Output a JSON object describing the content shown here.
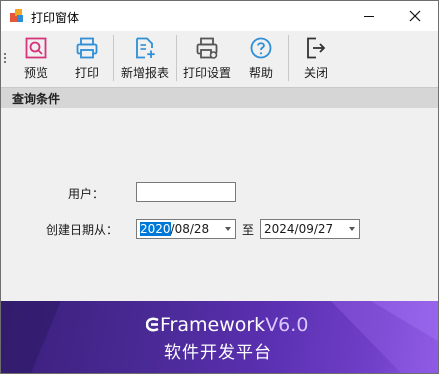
{
  "window": {
    "title": "打印窗体"
  },
  "toolbar": {
    "items": [
      {
        "label": "预览",
        "icon": "preview-icon"
      },
      {
        "label": "打印",
        "icon": "printer-icon"
      },
      {
        "label": "新增报表",
        "icon": "new-report-icon"
      },
      {
        "label": "打印设置",
        "icon": "print-settings-icon"
      },
      {
        "label": "帮助",
        "icon": "help-icon"
      },
      {
        "label": "关闭",
        "icon": "exit-icon"
      }
    ]
  },
  "section": {
    "title": "查询条件"
  },
  "form": {
    "user_label": "用户：",
    "user_value": "",
    "date_label": "创建日期从：",
    "date_from_year": "2020",
    "date_from_rest": "/08/28",
    "to_label": "至",
    "date_to": "2024/09/27"
  },
  "banner": {
    "brand": "Framework",
    "version": "V6.0",
    "slogan": "软件开发平台"
  },
  "colors": {
    "accent_blue": "#0078d7",
    "icon_blue": "#2e8fd6",
    "icon_pink": "#d6347a",
    "banner_purple": "#4a2a96"
  }
}
